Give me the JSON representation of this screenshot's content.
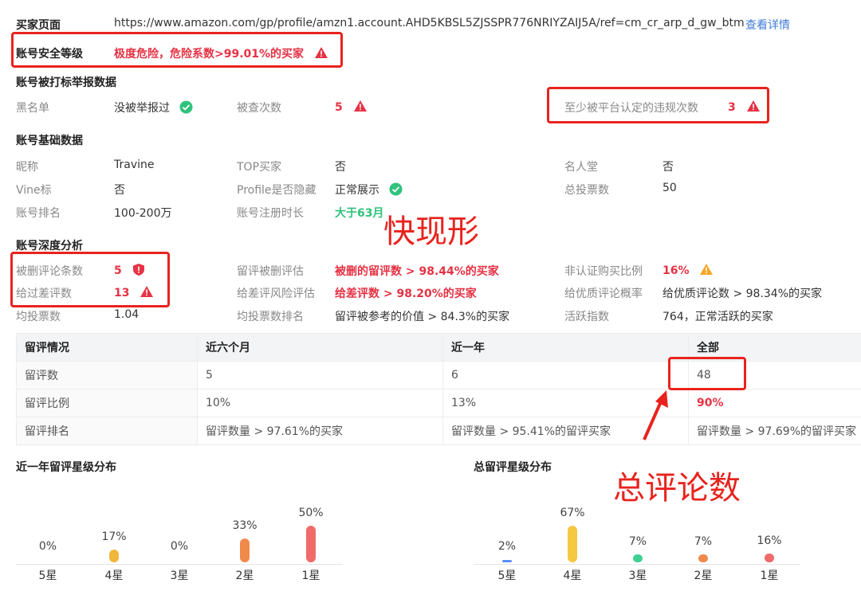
{
  "buyer_page": {
    "label": "买家页面",
    "url": "https://www.amazon.com/gp/profile/amzn1.account.AHD5KBSL5ZJSSPR776NRIYZAIJ5A/ref=cm_cr_arp_d_gw_btm",
    "details_link": "查看详情"
  },
  "security": {
    "label": "账号安全等级",
    "value": "极度危险，危险系数>99.01%的买家"
  },
  "report_section": {
    "title": "账号被打标举报数据",
    "blacklist_label": "黑名单",
    "blacklist_value": "没被举报过",
    "checked_label": "被查次数",
    "checked_value": "5",
    "violations_label": "至少被平台认定的违规次数",
    "violations_value": "3"
  },
  "basic_section": {
    "title": "账号基础数据",
    "rows": [
      [
        {
          "label": "昵称",
          "value": "Travine"
        },
        {
          "label": "TOP买家",
          "value": "否"
        },
        {
          "label": "名人堂",
          "value": "否"
        }
      ],
      [
        {
          "label": "Vine标",
          "value": "否"
        },
        {
          "label": "Profile是否隐藏",
          "value": "正常展示"
        },
        {
          "label": "总投票数",
          "value": "50"
        }
      ],
      [
        {
          "label": "账号排名",
          "value": "100-200万"
        },
        {
          "label": "账号注册时长",
          "value": "大于63月"
        }
      ]
    ]
  },
  "deep_section": {
    "title": "账号深度分析",
    "rows": [
      [
        {
          "label": "被删评论条数",
          "value": "5"
        },
        {
          "label": "留评被删评估",
          "value": "被删的留评数 > 98.44%的买家"
        },
        {
          "label": "非认证购买比例",
          "value": "16%"
        }
      ],
      [
        {
          "label": "给过差评数",
          "value": "13"
        },
        {
          "label": "给差评风险评估",
          "value": "给差评数 > 98.20%的买家"
        },
        {
          "label": "给优质评论概率",
          "value": "给优质评论数 > 98.34%的买家"
        }
      ],
      [
        {
          "label": "均投票数",
          "value": "1.04"
        },
        {
          "label": "均投票数排名",
          "value": "留评被参考的价值 > 84.3%的买家"
        },
        {
          "label": "活跃指数",
          "value": "764，正常活跃的买家"
        }
      ]
    ]
  },
  "review_table": {
    "headers": [
      "留评情况",
      "近六个月",
      "近一年",
      "全部"
    ],
    "rows": [
      [
        "留评数",
        "5",
        "6",
        "48"
      ],
      [
        "留评比例",
        "10%",
        "13%",
        "90%"
      ],
      [
        "留评排名",
        "留评数量 > 97.61%的买家",
        "留评数量 > 95.41%的留评买家",
        "留评数量 > 97.69%的留评买家"
      ]
    ]
  },
  "annotations": {
    "quick_show": "快现形",
    "total_reviews": "总评论数"
  },
  "chart_data": [
    {
      "type": "bar",
      "title": "近一年留评星级分布",
      "categories": [
        "5星",
        "4星",
        "3星",
        "2星",
        "1星"
      ],
      "values": [
        0,
        17,
        0,
        33,
        50
      ],
      "labels": [
        "0%",
        "17%",
        "0%",
        "33%",
        "50%"
      ],
      "colors": [
        "#f0b83a",
        "#f0b83a",
        "#f0b83a",
        "#f08a4b",
        "#f06a6a"
      ]
    },
    {
      "type": "bar",
      "title": "总留评星级分布",
      "categories": [
        "5星",
        "4星",
        "3星",
        "2星",
        "1星"
      ],
      "values": [
        2,
        67,
        7,
        7,
        16
      ],
      "labels": [
        "2%",
        "67%",
        "7%",
        "7%",
        "16%"
      ],
      "colors": [
        "#5b8ff9",
        "#f5c842",
        "#3fcf94",
        "#f08a4b",
        "#f06a6a"
      ]
    }
  ],
  "colors": {
    "danger": "#e63244",
    "ok": "#2fc27c",
    "link": "#3e7bd6",
    "annotation": "#e8231e",
    "warning": "#f5a623"
  }
}
